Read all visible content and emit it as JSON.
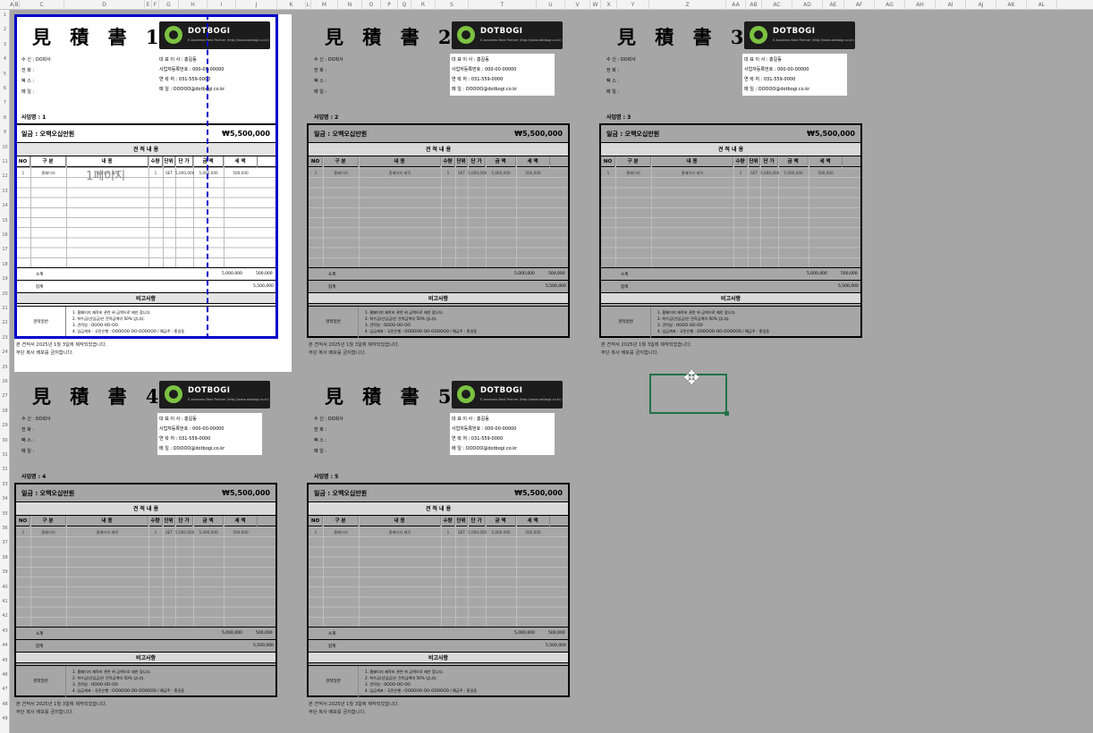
{
  "columns": [
    "A",
    "B",
    "C",
    "D",
    "E",
    "F",
    "G",
    "H",
    "I",
    "J",
    "K",
    "L",
    "M",
    "N",
    "O",
    "P",
    "Q",
    "R",
    "S",
    "T",
    "U",
    "V",
    "W",
    "X",
    "Y",
    "Z",
    "AA",
    "AB",
    "AC",
    "AD",
    "AE",
    "AF",
    "AG",
    "AH",
    "AI",
    "AJ",
    "AK",
    "AL"
  ],
  "rows": [
    "1",
    "2",
    "3",
    "4",
    "5",
    "6",
    "7",
    "8",
    "9",
    "10",
    "11",
    "12",
    "13",
    "14",
    "15",
    "16",
    "17",
    "18",
    "19",
    "20",
    "21",
    "22",
    "23",
    "24",
    "25",
    "26",
    "27",
    "28",
    "29",
    "30",
    "31",
    "32",
    "33",
    "34",
    "35",
    "36",
    "37",
    "38",
    "39",
    "40",
    "41",
    "42",
    "43",
    "44",
    "45",
    "46",
    "47",
    "48",
    "49"
  ],
  "common": {
    "logo_name": "DOTBOGI",
    "logo_slogan": "E-business Best Partner  (http://www.dotbogi.co.kr)",
    "recipient": "수   신 : OO회사",
    "phone": "전   화 :",
    "fax": "팩   스 :",
    "email": "메   일 :",
    "supplier_rep": "대   표   이   사  :  홍길동",
    "supplier_bizno": "사업자등록번호  :  000-00-00000",
    "supplier_tel": "연          락          처  :  031-559-0000",
    "supplier_mail": "메                    일  :  OOOOO@dotbogi.co.kr",
    "amount_label": "일금 : 오백오십만원",
    "amount_value": "₩5,500,000",
    "section_detail": "견 적 내 용",
    "headers": [
      "NO",
      "구   분",
      "내          용",
      "수량",
      "단위",
      "단 가",
      "금 액",
      "세 액"
    ],
    "row1": [
      "1",
      "홈페이지",
      "홈페이지 제작",
      "1",
      "SET",
      "5,000,000",
      "5,000,000",
      "500,000"
    ],
    "subtotal_label": "소계",
    "subtotal_amount": "5,000,000",
    "subtotal_tax": "500,000",
    "total_label": "합계",
    "total_value": "5,500,000",
    "section_notes": "비고사항",
    "notes_label": "견적일반",
    "notes": [
      "1. 홈페이지 제작비 관련 위 금액으로 제안 합니다.",
      "2. 착수금(선입금)은 견적금액의 50% 입니다.",
      "3. 견적일 : OOOO-OO-OO",
      "4. 입금계좌 : 국민은행 : OOOOOO-OO-OOOOOO   / 예금주 : 홍길동"
    ],
    "footer1": "본 견적서 2025년 1월 3일에 제작되었습니다.",
    "footer2": "무단 복사 배포를 금지합니다."
  },
  "sheets": [
    {
      "title": "見 積 書 1",
      "project": "사업명 : 1"
    },
    {
      "title": "見 積 書 2",
      "project": "사업명 : 2"
    },
    {
      "title": "見 積 書 3",
      "project": "사업명 : 3"
    },
    {
      "title": "見 積 書 4",
      "project": "사업명 : 4"
    },
    {
      "title": "見 積 書 5",
      "project": "사업명 : 5"
    }
  ],
  "page_watermark": "1페이지"
}
